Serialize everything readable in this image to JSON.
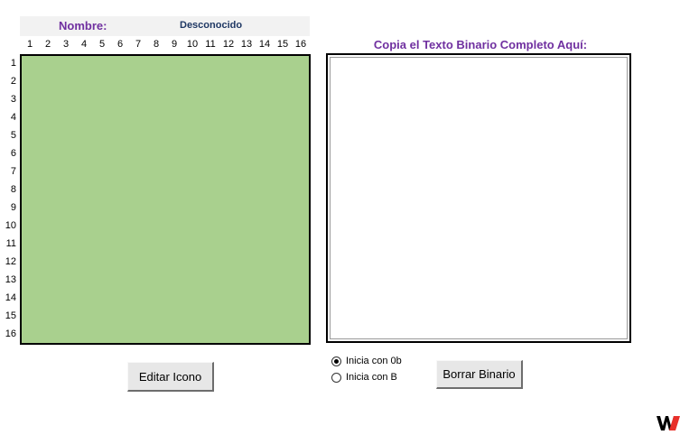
{
  "header": {
    "name_label": "Nombre:",
    "name_value": "Desconocido"
  },
  "grid": {
    "columns": [
      "1",
      "2",
      "3",
      "4",
      "5",
      "6",
      "7",
      "8",
      "9",
      "10",
      "11",
      "12",
      "13",
      "14",
      "15",
      "16"
    ],
    "rows": [
      "1",
      "2",
      "3",
      "4",
      "5",
      "6",
      "7",
      "8",
      "9",
      "10",
      "11",
      "12",
      "13",
      "14",
      "15",
      "16"
    ],
    "fill_color": "#a9d08e"
  },
  "binary": {
    "title": "Copia el Texto Binario Completo Aquí:",
    "value": ""
  },
  "options": {
    "radio_0b": {
      "label": "Inicia con 0b",
      "checked": true
    },
    "radio_b": {
      "label": "Inicia con B",
      "checked": false
    }
  },
  "buttons": {
    "edit_label": "Editar Icono",
    "clear_label": "Borrar Binario"
  },
  "colors": {
    "accent_purple": "#7030a0",
    "value_navy": "#1f3864",
    "logo_red": "#e8302a"
  }
}
